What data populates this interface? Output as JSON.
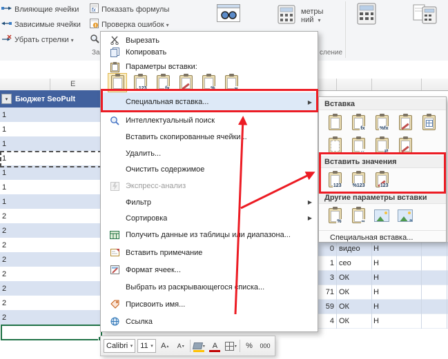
{
  "ribbon": {
    "trace_precedents": "Влияющие ячейки",
    "trace_dependents": "Зависимые ячейки",
    "remove_arrows": "Убрать стрелки",
    "show_formulas": "Показать формулы",
    "error_checking": "Проверка ошибок",
    "calc_options_partial_top": "метры",
    "calc_options_partial_bottom": "ний",
    "group_dependencies_partial": "За",
    "group_calculation_partial": "сление"
  },
  "sheet": {
    "column_header": "E",
    "table_header": "Бюджет SeoPult",
    "left_rows": [
      "1",
      "1",
      "1",
      "1",
      "1",
      "1",
      "1",
      "2",
      "2",
      "2",
      "2",
      "2",
      "2",
      "2",
      "2"
    ],
    "right_rows": [
      {
        "num": "0",
        "label": "видео",
        "flag": "Н"
      },
      {
        "num": "1",
        "label": "ceo",
        "flag": "Н"
      },
      {
        "num": "3",
        "label": "ОК",
        "flag": "Н"
      },
      {
        "num": "71",
        "label": "ОК",
        "flag": "Н"
      },
      {
        "num": "59",
        "label": "ОК",
        "flag": "Н"
      },
      {
        "num": "4",
        "label": "ОК",
        "flag": "Н"
      }
    ]
  },
  "menu": {
    "cut": "Вырезать",
    "copy": "Копировать",
    "paste_options": "Параметры вставки:",
    "paste_special": "Специальная вставка...",
    "smart_lookup": "Интеллектуальный поиск",
    "insert_copied": "Вставить скопированные ячейки...",
    "delete": "Удалить...",
    "clear_contents": "Очистить содержимое",
    "quick_analysis": "Экспресс-анализ",
    "filter": "Фильтр",
    "sort": "Сортировка",
    "get_data": "Получить данные из таблицы или диапазона...",
    "insert_note": "Вставить примечание",
    "format_cells": "Формат ячеек...",
    "pick_list": "Выбрать из раскрывающегося списка...",
    "define_name": "Присвоить имя...",
    "link": "Ссылка"
  },
  "submenu": {
    "section_paste": "Вставка",
    "section_values": "Вставить значения",
    "section_other": "Другие параметры вставки",
    "paste_special": "Специальная вставка..."
  },
  "mini_toolbar": {
    "font_name": "Calibri",
    "font_size": "11",
    "font_glyph": "А",
    "percent": "%",
    "thousands": "000"
  },
  "icons": {
    "dropdown": "▾",
    "up": "▴",
    "submenu_arrow": "▶",
    "badge_fx": "fx",
    "badge_pfx": "%fx",
    "badge_123": "123",
    "badge_p123": "%123",
    "badge_pct": "%",
    "badge_width": "↔",
    "badge_transpose": "⇄",
    "badge_link": "∞"
  },
  "colors": {
    "annotation_red": "#EC1C24",
    "band_blue": "#D9E2F1",
    "table_header_blue": "#41619E",
    "selection_green": "#1E7145"
  }
}
